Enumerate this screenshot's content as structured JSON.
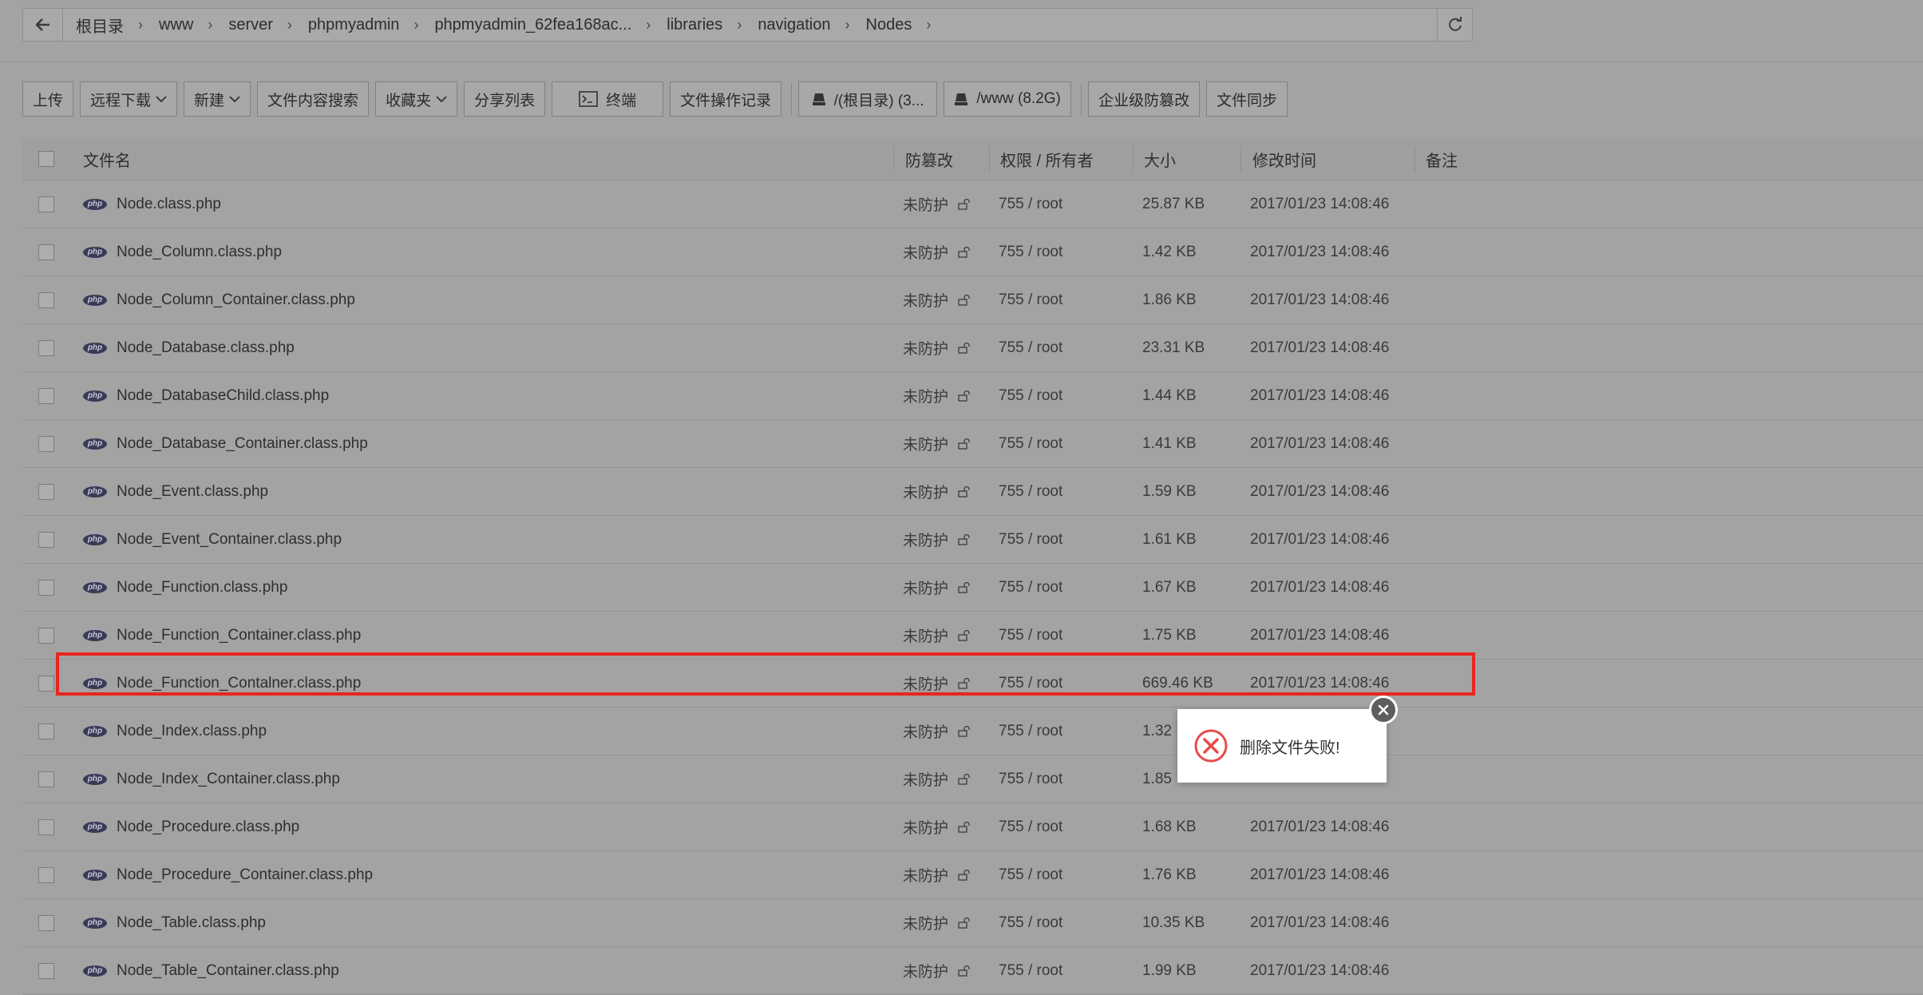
{
  "breadcrumb": {
    "items": [
      "根目录",
      "www",
      "server",
      "phpmyadmin",
      "phpmyadmin_62fea168ac...",
      "libraries",
      "navigation",
      "Nodes"
    ]
  },
  "toolbar": {
    "upload": "上传",
    "remote_download": "远程下载",
    "new": "新建",
    "content_search": "文件内容搜索",
    "favorites": "收藏夹",
    "share_list": "分享列表",
    "terminal": "终端",
    "operation_log": "文件操作记录",
    "disk_root": "/(根目录) (3...",
    "disk_www": "/www (8.2G)",
    "tamper_protect": "企业级防篡改",
    "file_sync": "文件同步"
  },
  "table": {
    "headers": {
      "name": "文件名",
      "tamper": "防篡改",
      "perm_owner": "权限 / 所有者",
      "size": "大小",
      "mtime": "修改时间",
      "remark": "备注"
    },
    "rows": [
      {
        "name": "Node.class.php",
        "tamper": "未防护",
        "perm": "755 / root",
        "size": "25.87 KB",
        "mtime": "2017/01/23 14:08:46"
      },
      {
        "name": "Node_Column.class.php",
        "tamper": "未防护",
        "perm": "755 / root",
        "size": "1.42 KB",
        "mtime": "2017/01/23 14:08:46"
      },
      {
        "name": "Node_Column_Container.class.php",
        "tamper": "未防护",
        "perm": "755 / root",
        "size": "1.86 KB",
        "mtime": "2017/01/23 14:08:46"
      },
      {
        "name": "Node_Database.class.php",
        "tamper": "未防护",
        "perm": "755 / root",
        "size": "23.31 KB",
        "mtime": "2017/01/23 14:08:46"
      },
      {
        "name": "Node_DatabaseChild.class.php",
        "tamper": "未防护",
        "perm": "755 / root",
        "size": "1.44 KB",
        "mtime": "2017/01/23 14:08:46"
      },
      {
        "name": "Node_Database_Container.class.php",
        "tamper": "未防护",
        "perm": "755 / root",
        "size": "1.41 KB",
        "mtime": "2017/01/23 14:08:46"
      },
      {
        "name": "Node_Event.class.php",
        "tamper": "未防护",
        "perm": "755 / root",
        "size": "1.59 KB",
        "mtime": "2017/01/23 14:08:46"
      },
      {
        "name": "Node_Event_Container.class.php",
        "tamper": "未防护",
        "perm": "755 / root",
        "size": "1.61 KB",
        "mtime": "2017/01/23 14:08:46"
      },
      {
        "name": "Node_Function.class.php",
        "tamper": "未防护",
        "perm": "755 / root",
        "size": "1.67 KB",
        "mtime": "2017/01/23 14:08:46"
      },
      {
        "name": "Node_Function_Container.class.php",
        "tamper": "未防护",
        "perm": "755 / root",
        "size": "1.75 KB",
        "mtime": "2017/01/23 14:08:46"
      },
      {
        "name": "Node_Function_Contalner.class.php",
        "tamper": "未防护",
        "perm": "755 / root",
        "size": "669.46 KB",
        "mtime": "2017/01/23 14:08:46"
      },
      {
        "name": "Node_Index.class.php",
        "tamper": "未防护",
        "perm": "755 / root",
        "size": "1.32",
        "mtime": ""
      },
      {
        "name": "Node_Index_Container.class.php",
        "tamper": "未防护",
        "perm": "755 / root",
        "size": "1.85",
        "mtime": ""
      },
      {
        "name": "Node_Procedure.class.php",
        "tamper": "未防护",
        "perm": "755 / root",
        "size": "1.68 KB",
        "mtime": "2017/01/23 14:08:46"
      },
      {
        "name": "Node_Procedure_Container.class.php",
        "tamper": "未防护",
        "perm": "755 / root",
        "size": "1.76 KB",
        "mtime": "2017/01/23 14:08:46"
      },
      {
        "name": "Node_Table.class.php",
        "tamper": "未防护",
        "perm": "755 / root",
        "size": "10.35 KB",
        "mtime": "2017/01/23 14:08:46"
      },
      {
        "name": "Node_Table_Container.class.php",
        "tamper": "未防护",
        "perm": "755 / root",
        "size": "1.99 KB",
        "mtime": "2017/01/23 14:08:46"
      }
    ]
  },
  "toast": {
    "message": "删除文件失败!",
    "type": "error"
  },
  "colors": {
    "highlight": "#e8261e",
    "error_icon": "#e84c4c"
  }
}
